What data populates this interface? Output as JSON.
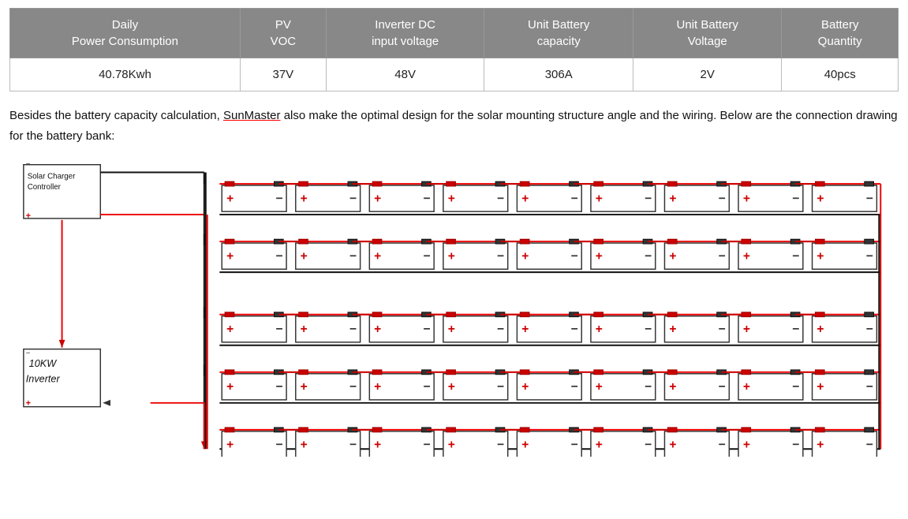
{
  "table": {
    "headers": [
      {
        "id": "daily-power",
        "line1": "Daily",
        "line2": "Power Consumption"
      },
      {
        "id": "pv-voc",
        "line1": "PV",
        "line2": "VOC"
      },
      {
        "id": "inverter-dc",
        "line1": "Inverter DC",
        "line2": "input voltage"
      },
      {
        "id": "unit-battery-capacity",
        "line1": "Unit Battery",
        "line2": "capacity"
      },
      {
        "id": "unit-battery-voltage",
        "line1": "Unit Battery",
        "line2": "Voltage"
      },
      {
        "id": "battery-quantity",
        "line1": "Battery",
        "line2": "Quantity"
      }
    ],
    "row": {
      "daily_power": "40.78Kwh",
      "pv_voc": "37V",
      "inverter_dc": "48V",
      "unit_battery_capacity": "306A",
      "unit_battery_voltage": "2V",
      "battery_quantity": "40pcs"
    }
  },
  "description": {
    "text_before": "Besides the battery capacity calculation, ",
    "brand": "SunMaster",
    "text_after": " also make the optimal design for the solar mounting structure angle and the wiring. Below are the connection drawing for the battery bank:"
  },
  "diagram": {
    "charger_label1": "Solar Charger",
    "charger_label2": "Controller",
    "inverter_label1": "10KW",
    "inverter_label2": "Inverter"
  }
}
